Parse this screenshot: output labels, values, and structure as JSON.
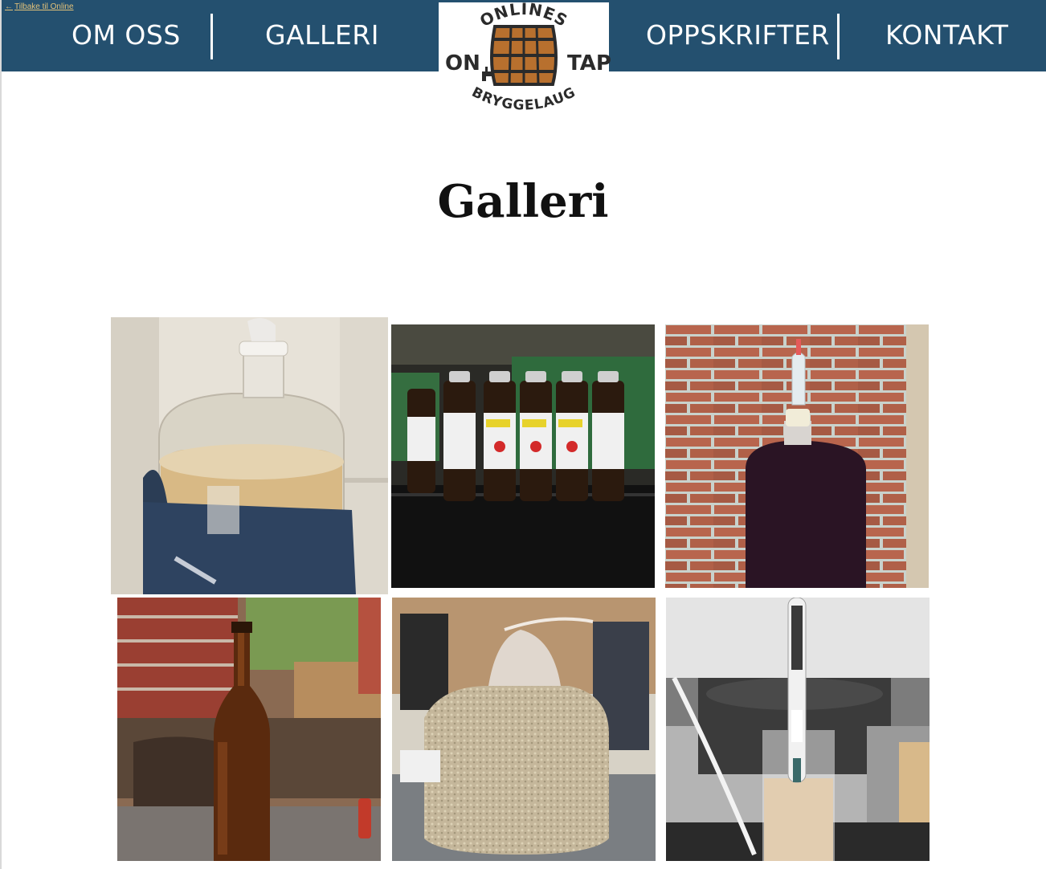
{
  "nav": {
    "back_link": "Tilbake til Online",
    "items": [
      "OM OSS",
      "GALLERI",
      "OPPSKRIFTER",
      "KONTAKT"
    ]
  },
  "logo": {
    "top_text": "ONLINES",
    "left_text": "ON",
    "right_text": "TAP",
    "bottom_text": "BRYGGELAUG"
  },
  "page": {
    "title": "Galleri"
  },
  "gallery": {
    "photos": [
      "carboy-fermenting-photo",
      "labeled-bottles-photo",
      "dark-brew-carboy-photo",
      "amber-bottle-outdoor-photo",
      "malt-grain-bag-photo",
      "hydrometer-cylinder-photo"
    ]
  },
  "colors": {
    "nav_background": "#24506f",
    "nav_text": "#ffffff",
    "back_link": "#e3c27a",
    "logo_barrel": "#b8702e"
  }
}
